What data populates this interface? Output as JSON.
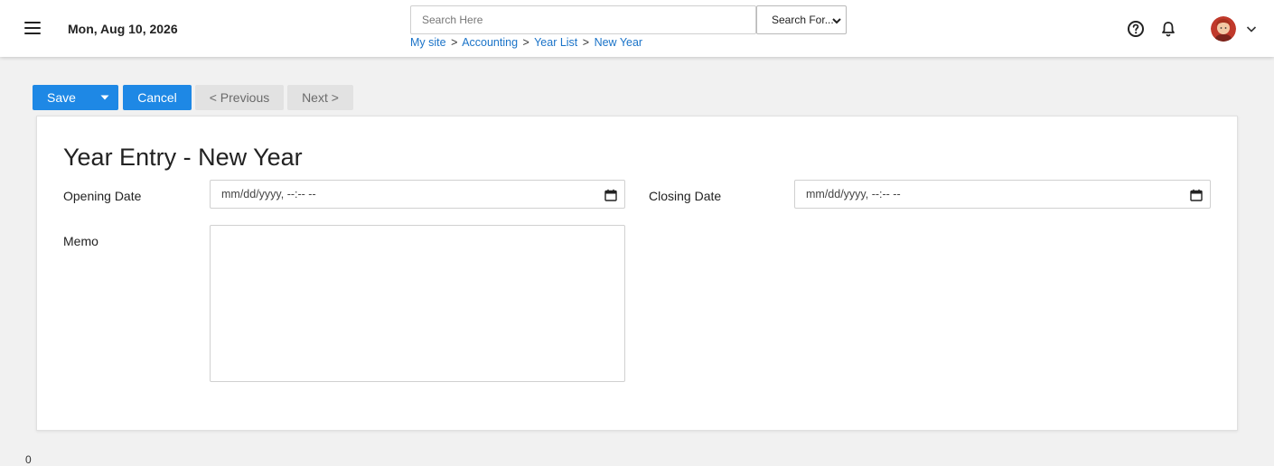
{
  "header": {
    "date": "Mon, Aug 10, 2026",
    "search": {
      "placeholder": "Search Here",
      "value": ""
    },
    "search_select": {
      "selected": "Search For..."
    },
    "breadcrumb": [
      {
        "label": "My site"
      },
      {
        "label": "Accounting"
      },
      {
        "label": "Year List"
      },
      {
        "label": "New Year"
      }
    ],
    "breadcrumb_separator": ">",
    "icons": {
      "menu": "hamburger-menu-icon",
      "help": "help-circle-icon",
      "notifications": "bell-icon",
      "user_menu": "chevron-down-icon"
    }
  },
  "toolbar": {
    "save_label": "Save",
    "cancel_label": "Cancel",
    "previous_label": "< Previous",
    "next_label": "Next >"
  },
  "form": {
    "title": "Year Entry - New Year",
    "opening_date": {
      "label": "Opening Date",
      "placeholder": "mm/dd/yyyy, --:-- --"
    },
    "closing_date": {
      "label": "Closing Date",
      "placeholder": "mm/dd/yyyy, --:-- --"
    },
    "memo": {
      "label": "Memo",
      "value": ""
    }
  },
  "footer": {
    "char": "0"
  },
  "colors": {
    "primary": "#1e88e5",
    "link": "#1a73c8",
    "disabled_bg": "#e2e2e2",
    "disabled_text": "#6b6b6b",
    "page_bg": "#f1f1f1"
  }
}
